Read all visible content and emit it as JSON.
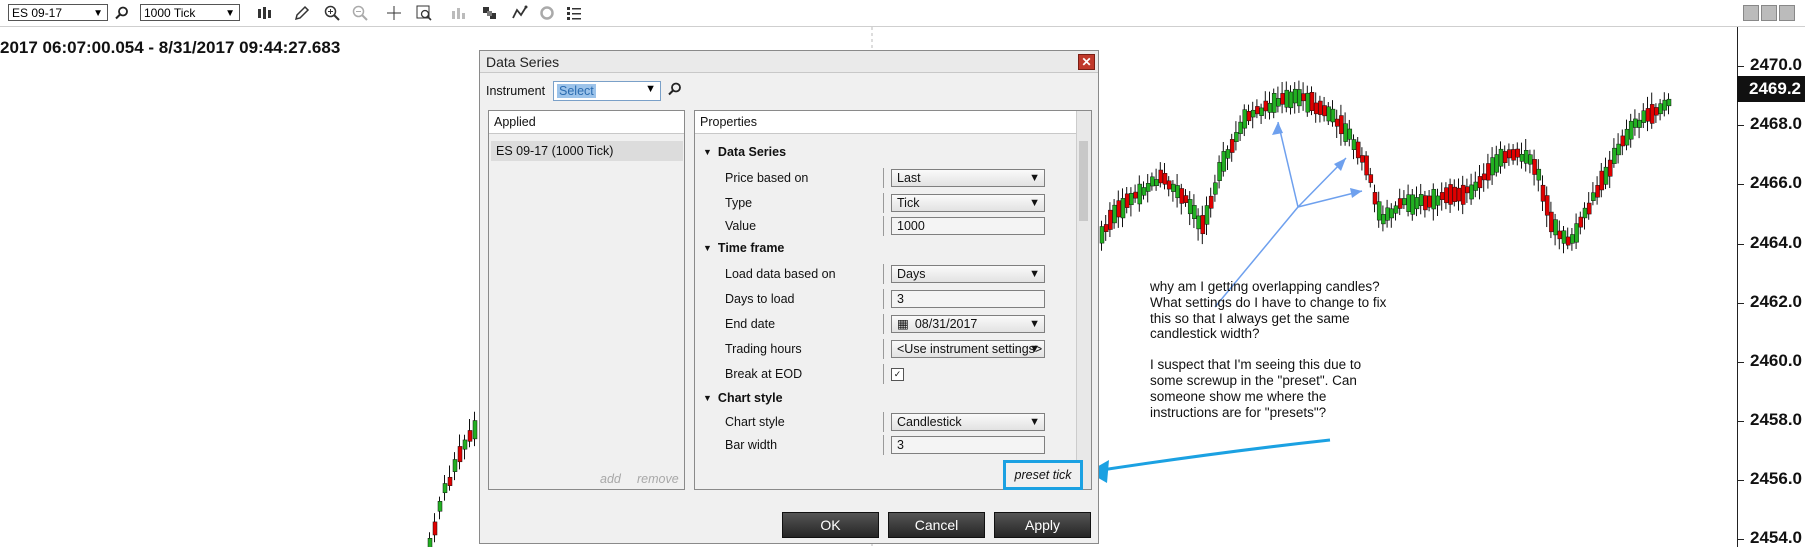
{
  "toolbar": {
    "instrument": "ES 09-17",
    "interval": "1000 Tick",
    "icons": [
      "bar-chart-icon",
      "pencil-icon",
      "zoom-in-icon",
      "zoom-out-icon",
      "crosshair-icon",
      "data-box-icon",
      "strategy-icon",
      "properties-icon",
      "indicator-icon",
      "refresh-icon",
      "list-icon"
    ]
  },
  "chart": {
    "date_range": "2017 06:07:00.054 - 8/31/2017 09:44:27.683",
    "current_price": "2469.2",
    "colors": {
      "up": "#22b022",
      "down": "#e00000",
      "wick": "#111111"
    }
  },
  "chart_data": {
    "type": "candlestick",
    "ylim": [
      2454.0,
      2470.0
    ],
    "y_ticks": [
      "2470.0",
      "2468.0",
      "2466.0",
      "2464.0",
      "2462.0",
      "2460.0",
      "2458.0",
      "2456.0",
      "2454.0"
    ],
    "last_price": 2469.2
  },
  "annotation": {
    "paragraph1": "why am I getting overlapping candles? What settings do I have to change to fix this so that I always get the same candlestick width?",
    "paragraph2": "I suspect that I'm seeing this due to some screwup in the \"preset\". Can someone show me where the instructions are for \"presets\"?"
  },
  "dialog": {
    "title": "Data Series",
    "instrument_label": "Instrument",
    "instrument_value": "Select",
    "applied_header": "Applied",
    "applied_items": [
      "ES 09-17 (1000 Tick)"
    ],
    "add_label": "add",
    "remove_label": "remove",
    "properties_header": "Properties",
    "sections": {
      "data_series": "Data Series",
      "time_frame": "Time frame",
      "chart_style": "Chart style"
    },
    "rows": {
      "price_based_on": {
        "label": "Price based on",
        "value": "Last"
      },
      "type": {
        "label": "Type",
        "value": "Tick"
      },
      "value": {
        "label": "Value",
        "value": "1000"
      },
      "load_data_based_on": {
        "label": "Load data based on",
        "value": "Days"
      },
      "days_to_load": {
        "label": "Days to load",
        "value": "3"
      },
      "end_date": {
        "label": "End date",
        "value": "08/31/2017"
      },
      "trading_hours": {
        "label": "Trading hours",
        "value": "<Use instrument settings>"
      },
      "break_at_eod": {
        "label": "Break at EOD",
        "checked": true
      },
      "chart_style": {
        "label": "Chart style",
        "value": "Candlestick"
      },
      "bar_width": {
        "label": "Bar width",
        "value": "3"
      }
    },
    "preset_label": "preset tick",
    "ok_label": "OK",
    "cancel_label": "Cancel",
    "apply_label": "Apply"
  }
}
